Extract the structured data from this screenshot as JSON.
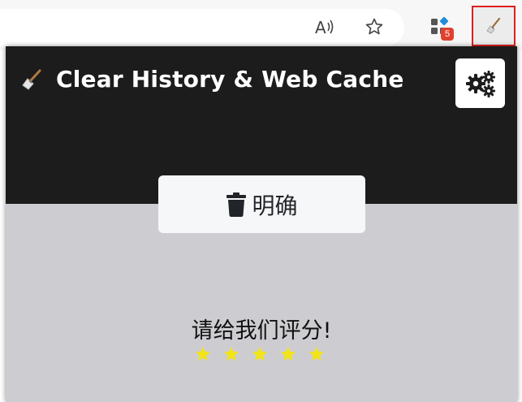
{
  "toolbar": {
    "read_aloud_icon": "read-aloud-icon",
    "favorite_icon": "star-outline-icon",
    "extensions_badge": "5",
    "extension_icon": "broom-icon"
  },
  "popup": {
    "title": "Clear History & Web Cache",
    "clear_button_label": "明确",
    "rate_prompt": "请给我们评分!",
    "star_count": 5,
    "colors": {
      "header_bg": "#1c1c1c",
      "body_bg": "#cdcdd1",
      "star": "#f2e41a"
    }
  }
}
